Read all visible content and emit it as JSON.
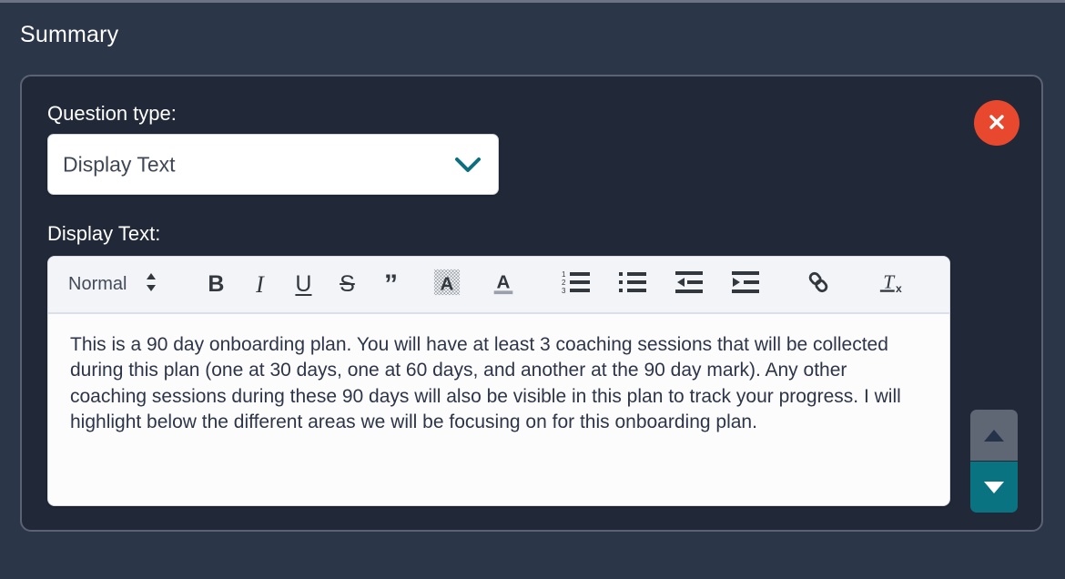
{
  "page": {
    "title": "Summary",
    "background_color": "#2b3649",
    "panel_background_color": "#212838",
    "accent_teal": "#0a7382",
    "close_red": "#e8492e"
  },
  "panel": {
    "question_type": {
      "label": "Question type:",
      "selected_value": "Display Text",
      "chevron_icon": "chevron-down-icon"
    },
    "display_text": {
      "label": "Display Text:",
      "body": "This is a 90 day onboarding plan. You will have at least 3 coaching sessions that will be collected during this plan (one at 30 days, one at 60 days, and another at the 90 day mark). Any other coaching sessions during these 90 days will also be visible in this plan to track your progress. I will highlight below the different areas we will be focusing on for this onboarding plan."
    },
    "close_button": {
      "icon": "close-icon",
      "label": "Close"
    }
  },
  "toolbar": {
    "format_select": {
      "value": "Normal",
      "icon": "updown-arrows-icon"
    },
    "buttons": [
      {
        "name": "bold-button",
        "icon": "bold-icon",
        "glyph": "B"
      },
      {
        "name": "italic-button",
        "icon": "italic-icon",
        "glyph": "I"
      },
      {
        "name": "underline-button",
        "icon": "underline-icon",
        "glyph": "U"
      },
      {
        "name": "strikethrough-button",
        "icon": "strikethrough-icon",
        "glyph": "S"
      },
      {
        "name": "blockquote-button",
        "icon": "quote-icon",
        "glyph": "”"
      },
      {
        "name": "background-color-button",
        "icon": "background-color-icon",
        "glyph": "A"
      },
      {
        "name": "font-color-button",
        "icon": "font-color-icon",
        "glyph": "A"
      },
      {
        "name": "ordered-list-button",
        "icon": "ordered-list-icon",
        "glyph": ""
      },
      {
        "name": "bullet-list-button",
        "icon": "bullet-list-icon",
        "glyph": ""
      },
      {
        "name": "outdent-button",
        "icon": "outdent-icon",
        "glyph": ""
      },
      {
        "name": "indent-button",
        "icon": "indent-icon",
        "glyph": ""
      },
      {
        "name": "link-button",
        "icon": "link-icon",
        "glyph": ""
      },
      {
        "name": "clear-formatting-button",
        "icon": "clear-formatting-icon",
        "glyph": ""
      }
    ],
    "ordered_list_numbers": [
      "1",
      "2",
      "3"
    ]
  },
  "arrows": {
    "move_up": {
      "icon": "triangle-up-icon",
      "label": "Move up"
    },
    "move_down": {
      "icon": "triangle-down-icon",
      "label": "Move down"
    }
  }
}
